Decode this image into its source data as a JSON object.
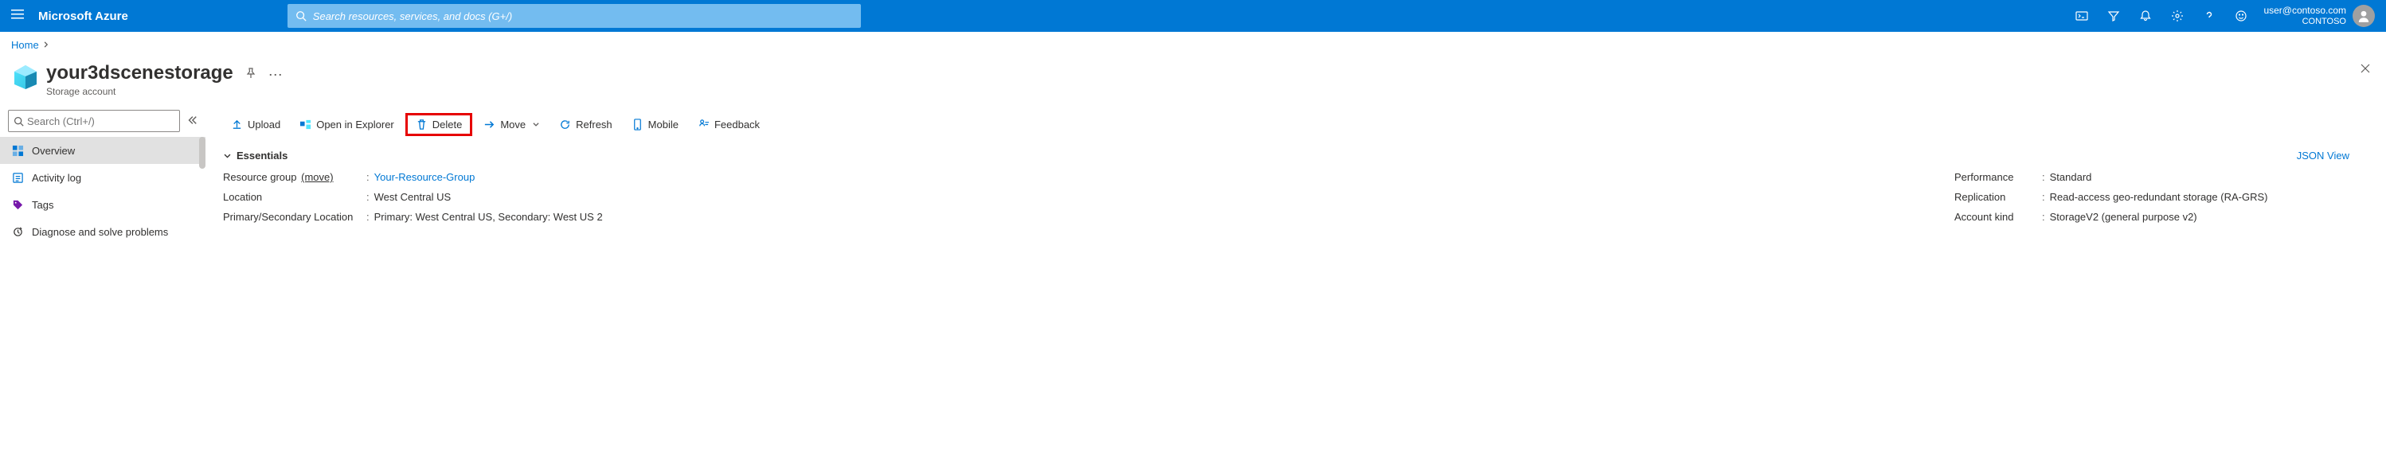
{
  "header": {
    "brand": "Microsoft Azure",
    "search_placeholder": "Search resources, services, and docs (G+/)",
    "user_email": "user@contoso.com",
    "tenant": "CONTOSO"
  },
  "breadcrumb": {
    "items": [
      "Home"
    ]
  },
  "blade": {
    "title": "your3dscenestorage",
    "subtitle": "Storage account"
  },
  "leftnav": {
    "search_placeholder": "Search (Ctrl+/)",
    "items": [
      {
        "label": "Overview",
        "icon": "overview",
        "selected": true
      },
      {
        "label": "Activity log",
        "icon": "activitylog",
        "selected": false
      },
      {
        "label": "Tags",
        "icon": "tags",
        "selected": false
      },
      {
        "label": "Diagnose and solve problems",
        "icon": "diagnose",
        "selected": false
      }
    ]
  },
  "commands": {
    "upload": "Upload",
    "open_explorer": "Open in Explorer",
    "delete": "Delete",
    "move": "Move",
    "refresh": "Refresh",
    "mobile": "Mobile",
    "feedback": "Feedback"
  },
  "essentials": {
    "header": "Essentials",
    "json_view": "JSON View",
    "left": [
      {
        "label": "Resource group",
        "labelsuffix": "(move)",
        "value": "Your-Resource-Group",
        "link": true
      },
      {
        "label": "Location",
        "value": "West Central US"
      },
      {
        "label": "Primary/Secondary Location",
        "value": "Primary: West Central US, Secondary: West US 2"
      }
    ],
    "right": [
      {
        "label": "Performance",
        "value": "Standard"
      },
      {
        "label": "Replication",
        "value": "Read-access geo-redundant storage (RA-GRS)"
      },
      {
        "label": "Account kind",
        "value": "StorageV2 (general purpose v2)"
      }
    ]
  }
}
